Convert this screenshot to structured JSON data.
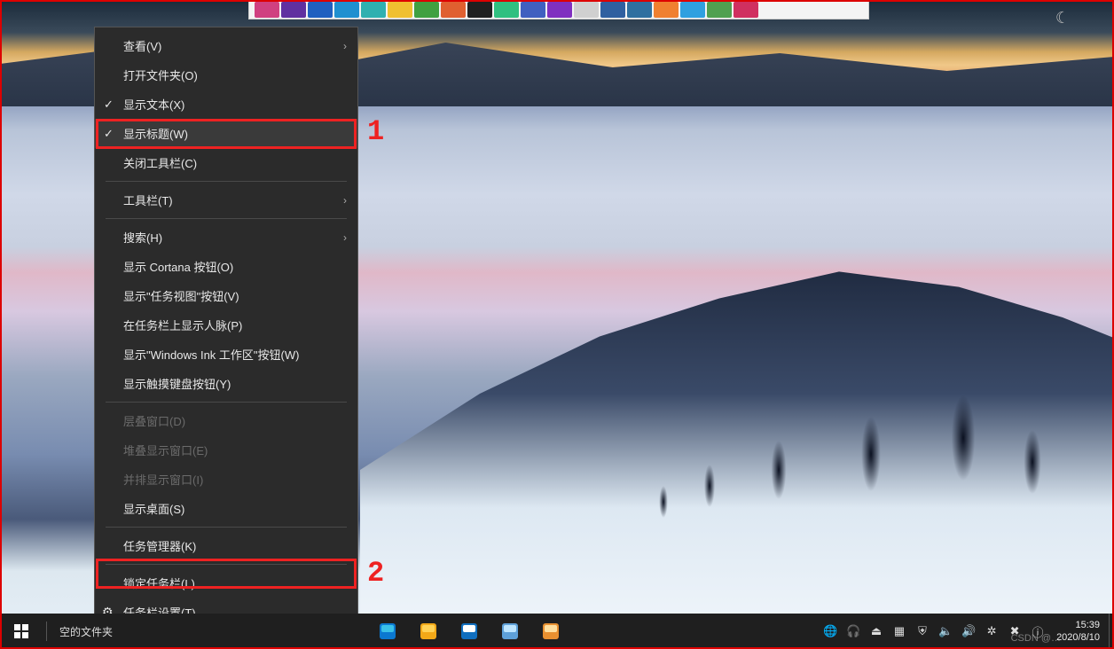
{
  "annotations": {
    "box1_num": "1",
    "box2_num": "2"
  },
  "context_menu": {
    "items": [
      {
        "label": "查看(V)",
        "submenu": true
      },
      {
        "label": "打开文件夹(O)"
      },
      {
        "label": "显示文本(X)",
        "checked": true
      },
      {
        "label": "显示标题(W)",
        "checked": true,
        "highlight": true
      },
      {
        "label": "关闭工具栏(C)"
      }
    ],
    "group2": [
      {
        "label": "工具栏(T)",
        "submenu": true
      }
    ],
    "group3": [
      {
        "label": "搜索(H)",
        "submenu": true
      },
      {
        "label": "显示 Cortana 按钮(O)"
      },
      {
        "label": "显示\"任务视图\"按钮(V)"
      },
      {
        "label": "在任务栏上显示人脉(P)"
      },
      {
        "label": "显示\"Windows Ink 工作区\"按钮(W)"
      },
      {
        "label": "显示触摸键盘按钮(Y)"
      }
    ],
    "group4": [
      {
        "label": "层叠窗口(D)",
        "disabled": true
      },
      {
        "label": "堆叠显示窗口(E)",
        "disabled": true
      },
      {
        "label": "并排显示窗口(I)",
        "disabled": true
      },
      {
        "label": "显示桌面(S)"
      }
    ],
    "group5": [
      {
        "label": "任务管理器(K)"
      }
    ],
    "group6": [
      {
        "label": "锁定任务栏(L)"
      },
      {
        "label": "任务栏设置(T)",
        "gear": true
      }
    ]
  },
  "taskbar": {
    "toolbar_label": "空的文件夹",
    "clock_time": "15:39",
    "clock_date": "2020/8/10",
    "pinned": [
      {
        "name": "edge",
        "color1": "#3ac1e8",
        "color2": "#0b78d0"
      },
      {
        "name": "explorer",
        "color1": "#ffd257",
        "color2": "#f2a818"
      },
      {
        "name": "store",
        "color1": "#ffffff",
        "color2": "#106ebe"
      },
      {
        "name": "app-a",
        "color1": "#bfe6ff",
        "color2": "#5ea0d8"
      },
      {
        "name": "app-b",
        "color1": "#ffe0a0",
        "color2": "#e89030"
      }
    ],
    "tray": [
      "globe",
      "headset",
      "usb",
      "grid",
      "shield",
      "speaker",
      "volume",
      "net",
      "battery",
      "ime"
    ]
  },
  "top_dock_colors": [
    "#d04080",
    "#6030a0",
    "#2060c0",
    "#2090d0",
    "#30b0b0",
    "#f0c030",
    "#40a040",
    "#e06030",
    "#202020",
    "#30c080",
    "#4060c0",
    "#8030c0",
    "#d0d0d0",
    "#3060a0",
    "#3070a0",
    "#f08030",
    "#30a0e0",
    "#50a050",
    "#d03060"
  ],
  "watermark": "CSDN @…"
}
